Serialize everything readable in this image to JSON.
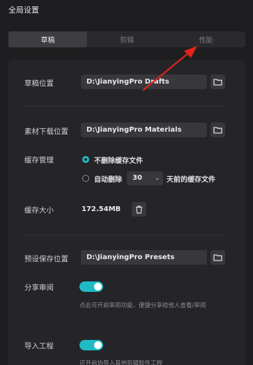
{
  "header": {
    "title": "全局设置"
  },
  "tabs": [
    {
      "label": "草稿",
      "active": true
    },
    {
      "label": "剪辑",
      "active": false
    },
    {
      "label": "性能",
      "active": false
    }
  ],
  "draft_location": {
    "label": "草稿位置",
    "value": "D:\\JianyingPro Drafts",
    "icon": "folder-icon"
  },
  "material_download": {
    "label": "素材下载位置",
    "value": "D:\\JianyingPro Materials",
    "icon": "folder-icon"
  },
  "cache_management": {
    "label": "缓存管理",
    "option_keep": "不删除缓存文件",
    "option_auto_prefix": "自动删除",
    "days_value": "30",
    "option_auto_suffix": "天前的缓存文件",
    "selected": "keep"
  },
  "cache_size": {
    "label": "缓存大小",
    "value": "172.54MB",
    "icon": "trash-icon"
  },
  "preset_location": {
    "label": "预设保存位置",
    "value": "D:\\JianyingPro Presets",
    "icon": "folder-icon"
  },
  "share_review": {
    "label": "分享审阅",
    "enabled": true,
    "hint": "点此可开启审阅功能，便捷分享给他人查看/审阅"
  },
  "import_project": {
    "label": "导入工程",
    "enabled": true,
    "hint": "可开启协导入其他剪辑软件工程"
  },
  "colors": {
    "accent": "#1fbac6",
    "annotation_arrow": "#e0241b",
    "background": "#1e1e20",
    "panel": "#252528"
  }
}
